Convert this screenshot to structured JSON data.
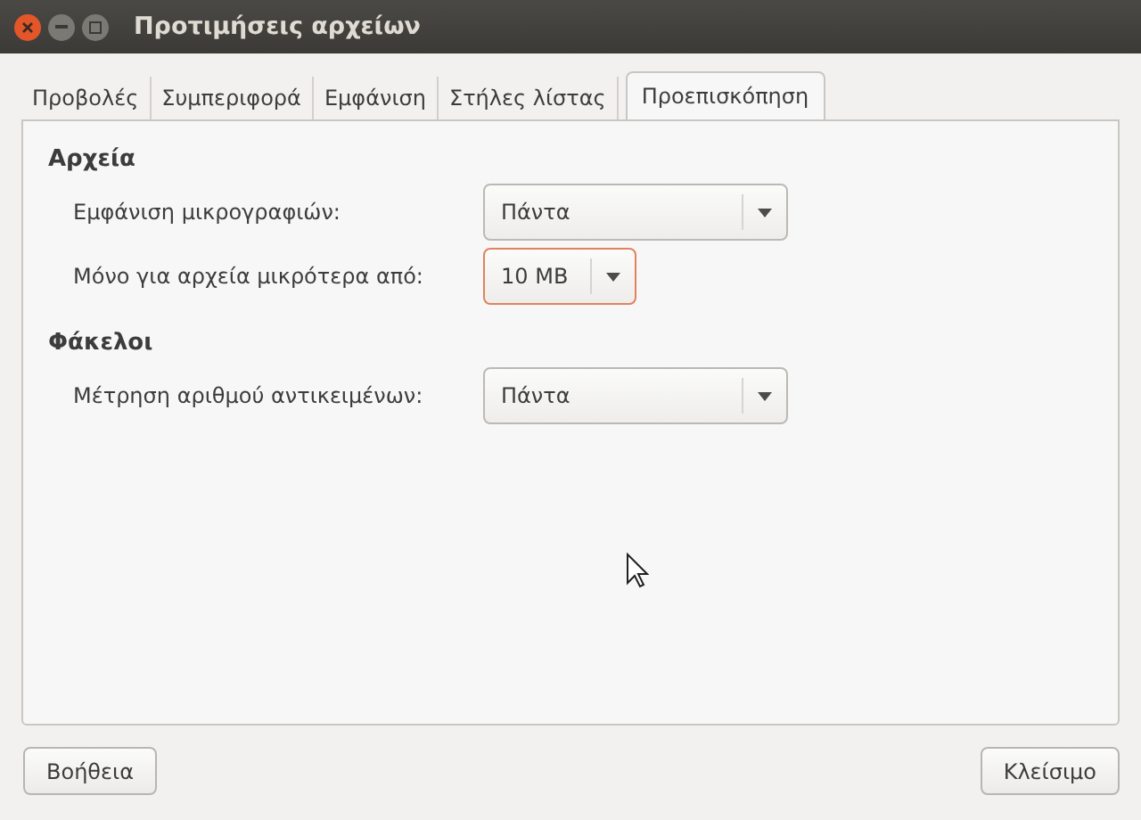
{
  "window": {
    "title": "Προτιμήσεις αρχείων"
  },
  "tabs": [
    {
      "label": "Προβολές",
      "selected": false
    },
    {
      "label": "Συμπεριφορά",
      "selected": false
    },
    {
      "label": "Εμφάνιση",
      "selected": false
    },
    {
      "label": "Στήλες λίστας",
      "selected": false
    },
    {
      "label": "Προεπισκόπηση",
      "selected": true
    }
  ],
  "sections": [
    {
      "heading": "Αρχεία",
      "rows": [
        {
          "label": "Εμφάνιση μικρογραφιών:",
          "value": "Πάντα",
          "focused": false,
          "wide": true
        },
        {
          "label": "Μόνο για αρχεία μικρότερα από:",
          "value": "10 MB",
          "focused": true,
          "wide": false
        }
      ]
    },
    {
      "heading": "Φάκελοι",
      "rows": [
        {
          "label": "Μέτρηση αριθμού αντικειμένων:",
          "value": "Πάντα",
          "focused": false,
          "wide": true
        }
      ]
    }
  ],
  "buttons": [
    "Βοήθεια",
    "Κλείσιμο"
  ]
}
